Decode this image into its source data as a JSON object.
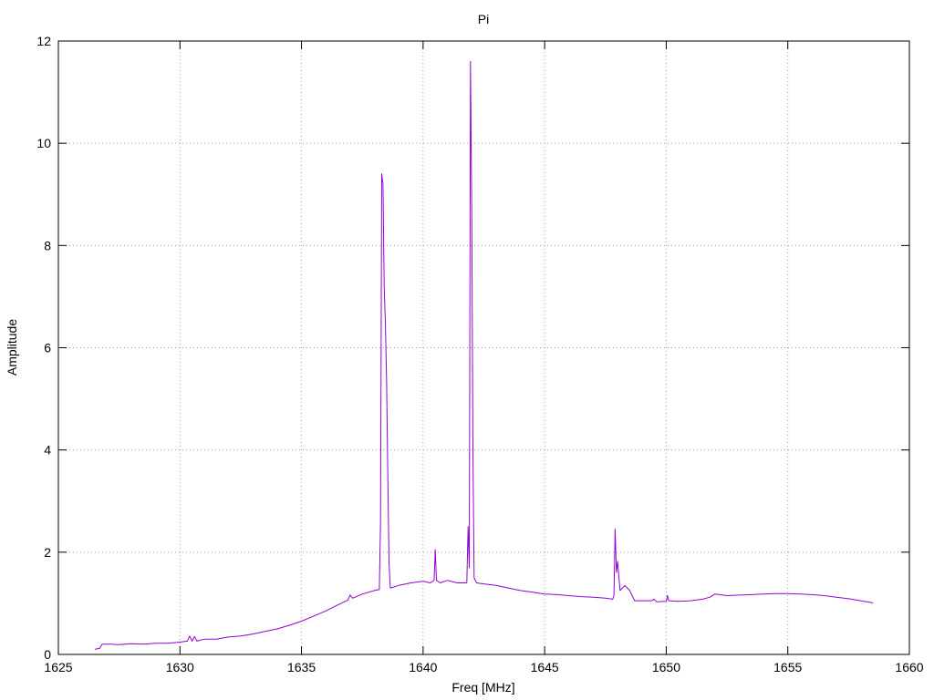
{
  "chart_data": {
    "type": "line",
    "title": "Pi",
    "xlabel": "Freq [MHz]",
    "ylabel": "Amplitude",
    "xlim": [
      1625,
      1660
    ],
    "ylim": [
      0,
      12
    ],
    "xticks": [
      1625,
      1630,
      1635,
      1640,
      1645,
      1650,
      1655,
      1660
    ],
    "yticks": [
      0,
      2,
      4,
      6,
      8,
      10,
      12
    ],
    "grid": true,
    "line_color": "#9400D3",
    "series": [
      {
        "x": [
          1626.5,
          1626.7,
          1626.8,
          1627.2,
          1627.5,
          1628,
          1628.5,
          1629,
          1629.5,
          1630,
          1630.3,
          1630.4,
          1630.5,
          1630.6,
          1630.7,
          1631,
          1631.5,
          1632,
          1632.5,
          1633,
          1633.5,
          1634,
          1634.5,
          1635,
          1635.5,
          1636,
          1636.5,
          1636.9,
          1637.0,
          1637.1,
          1637.5,
          1638.0,
          1638.2,
          1638.25,
          1638.3,
          1638.35,
          1638.4,
          1638.45,
          1638.5,
          1638.55,
          1638.6,
          1638.65,
          1638.8,
          1639.0,
          1639.5,
          1640.0,
          1640.3,
          1640.45,
          1640.5,
          1640.55,
          1640.7,
          1641.0,
          1641.4,
          1641.8,
          1641.85,
          1641.9,
          1641.95,
          1642.0,
          1642.05,
          1642.1,
          1642.2,
          1642.5,
          1643.0,
          1643.5,
          1644.0,
          1644.5,
          1645.0,
          1645.5,
          1646.0,
          1646.5,
          1647.0,
          1647.5,
          1647.8,
          1647.85,
          1647.9,
          1647.95,
          1648.0,
          1648.1,
          1648.3,
          1648.5,
          1648.7,
          1649.0,
          1649.4,
          1649.5,
          1649.6,
          1650.0,
          1650.05,
          1650.1,
          1650.5,
          1651.0,
          1651.5,
          1651.8,
          1652.0,
          1652.5,
          1653.0,
          1653.5,
          1654.0,
          1654.5,
          1655.0,
          1655.5,
          1656.0,
          1656.5,
          1657.0,
          1657.5,
          1658.0,
          1658.5
        ],
        "y": [
          0.1,
          0.12,
          0.2,
          0.2,
          0.19,
          0.21,
          0.2,
          0.22,
          0.22,
          0.24,
          0.26,
          0.36,
          0.26,
          0.35,
          0.26,
          0.3,
          0.3,
          0.34,
          0.36,
          0.4,
          0.45,
          0.5,
          0.57,
          0.65,
          0.75,
          0.85,
          0.97,
          1.06,
          1.16,
          1.1,
          1.18,
          1.25,
          1.27,
          2.6,
          9.4,
          9.2,
          7.2,
          6.5,
          5.3,
          3.5,
          1.8,
          1.3,
          1.32,
          1.35,
          1.4,
          1.43,
          1.4,
          1.45,
          2.05,
          1.45,
          1.4,
          1.45,
          1.4,
          1.4,
          2.5,
          1.7,
          11.6,
          8.7,
          4.0,
          1.5,
          1.4,
          1.38,
          1.35,
          1.3,
          1.25,
          1.22,
          1.18,
          1.17,
          1.15,
          1.13,
          1.12,
          1.1,
          1.08,
          1.15,
          2.45,
          1.6,
          1.82,
          1.25,
          1.35,
          1.25,
          1.05,
          1.05,
          1.05,
          1.08,
          1.03,
          1.04,
          1.15,
          1.05,
          1.04,
          1.05,
          1.08,
          1.12,
          1.18,
          1.15,
          1.16,
          1.17,
          1.18,
          1.19,
          1.19,
          1.18,
          1.17,
          1.15,
          1.12,
          1.09,
          1.05,
          1.01
        ]
      }
    ]
  }
}
